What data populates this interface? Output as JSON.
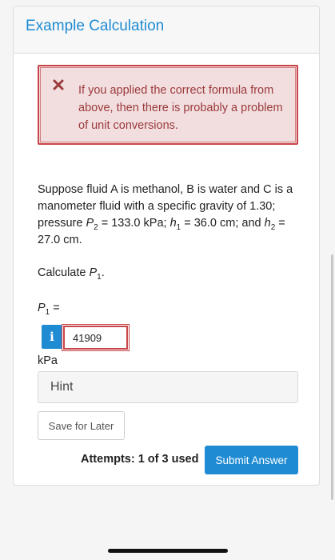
{
  "card": {
    "title": "Example Calculation"
  },
  "alert": {
    "icon": "close-x-icon",
    "message": "If you applied the correct formula from above, then there is probably a problem of unit conversions."
  },
  "problem": {
    "text_1": "Suppose fluid A is methanol, B is water and C is a manometer fluid with a specific gravity of 1.30; pressure ",
    "p2_symbol": "P",
    "p2_sub": "2",
    "text_2": " = 133.0 kPa; ",
    "h1_symbol": "h",
    "h1_sub": "1",
    "text_3": " = 36.0 cm; and ",
    "h2_symbol": "h",
    "h2_sub": "2",
    "text_4": " = 27.0 cm."
  },
  "question": {
    "prefix": "Calculate ",
    "symbol": "P",
    "sub": "1",
    "suffix": "."
  },
  "answer": {
    "label_symbol": "P",
    "label_sub": "1",
    "label_suffix": " =",
    "info_glyph": "i",
    "value": "41909",
    "unit": "kPa"
  },
  "hint": {
    "label": "Hint"
  },
  "buttons": {
    "save": "Save for Later",
    "submit": "Submit Answer"
  },
  "attempts": {
    "text": "Attempts: 1 of 3 used"
  },
  "colors": {
    "accent": "#1e8bd3",
    "error_border": "#c8464a",
    "error_bg": "#f2dede",
    "error_text": "#9b3a3d"
  }
}
